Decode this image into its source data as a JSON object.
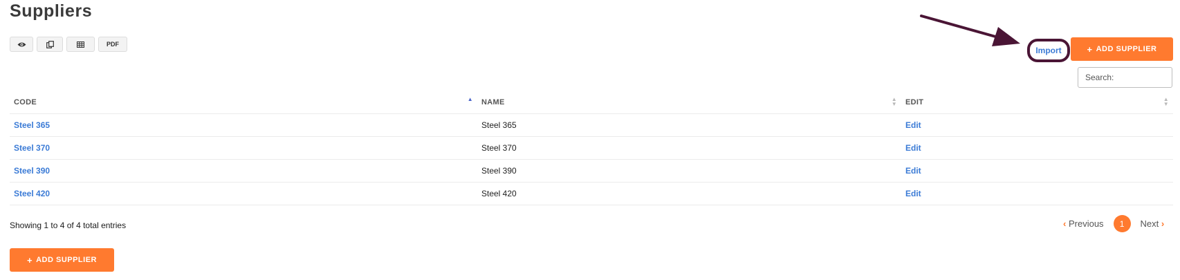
{
  "page": {
    "title": "Suppliers"
  },
  "export_buttons": [
    {
      "icon": "eye-icon"
    },
    {
      "icon": "copy-icon"
    },
    {
      "icon": "spreadsheet-icon"
    },
    {
      "label": "PDF"
    }
  ],
  "toolbar": {
    "import_label": "Import",
    "add_label": "ADD SUPPLIER",
    "add_icon": "+"
  },
  "search": {
    "placeholder": "Search:"
  },
  "table": {
    "headers": {
      "code": "CODE",
      "name": "NAME",
      "edit": "EDIT"
    },
    "sort": {
      "column": "CODE",
      "direction": "ascending"
    },
    "rows": [
      {
        "code": "Steel 365",
        "name": "Steel 365",
        "edit": "Edit"
      },
      {
        "code": "Steel 370",
        "name": "Steel 370",
        "edit": "Edit"
      },
      {
        "code": "Steel 390",
        "name": "Steel 390",
        "edit": "Edit"
      },
      {
        "code": "Steel 420",
        "name": "Steel 420",
        "edit": "Edit"
      }
    ]
  },
  "footer": {
    "info": "Showing 1 to 4 of 4 total entries"
  },
  "pagination": {
    "prev": "Previous",
    "current": "1",
    "next": "Next"
  },
  "colors": {
    "accent": "#ff7a2f",
    "link": "#3b7bd6",
    "annotation": "#4a1535"
  }
}
